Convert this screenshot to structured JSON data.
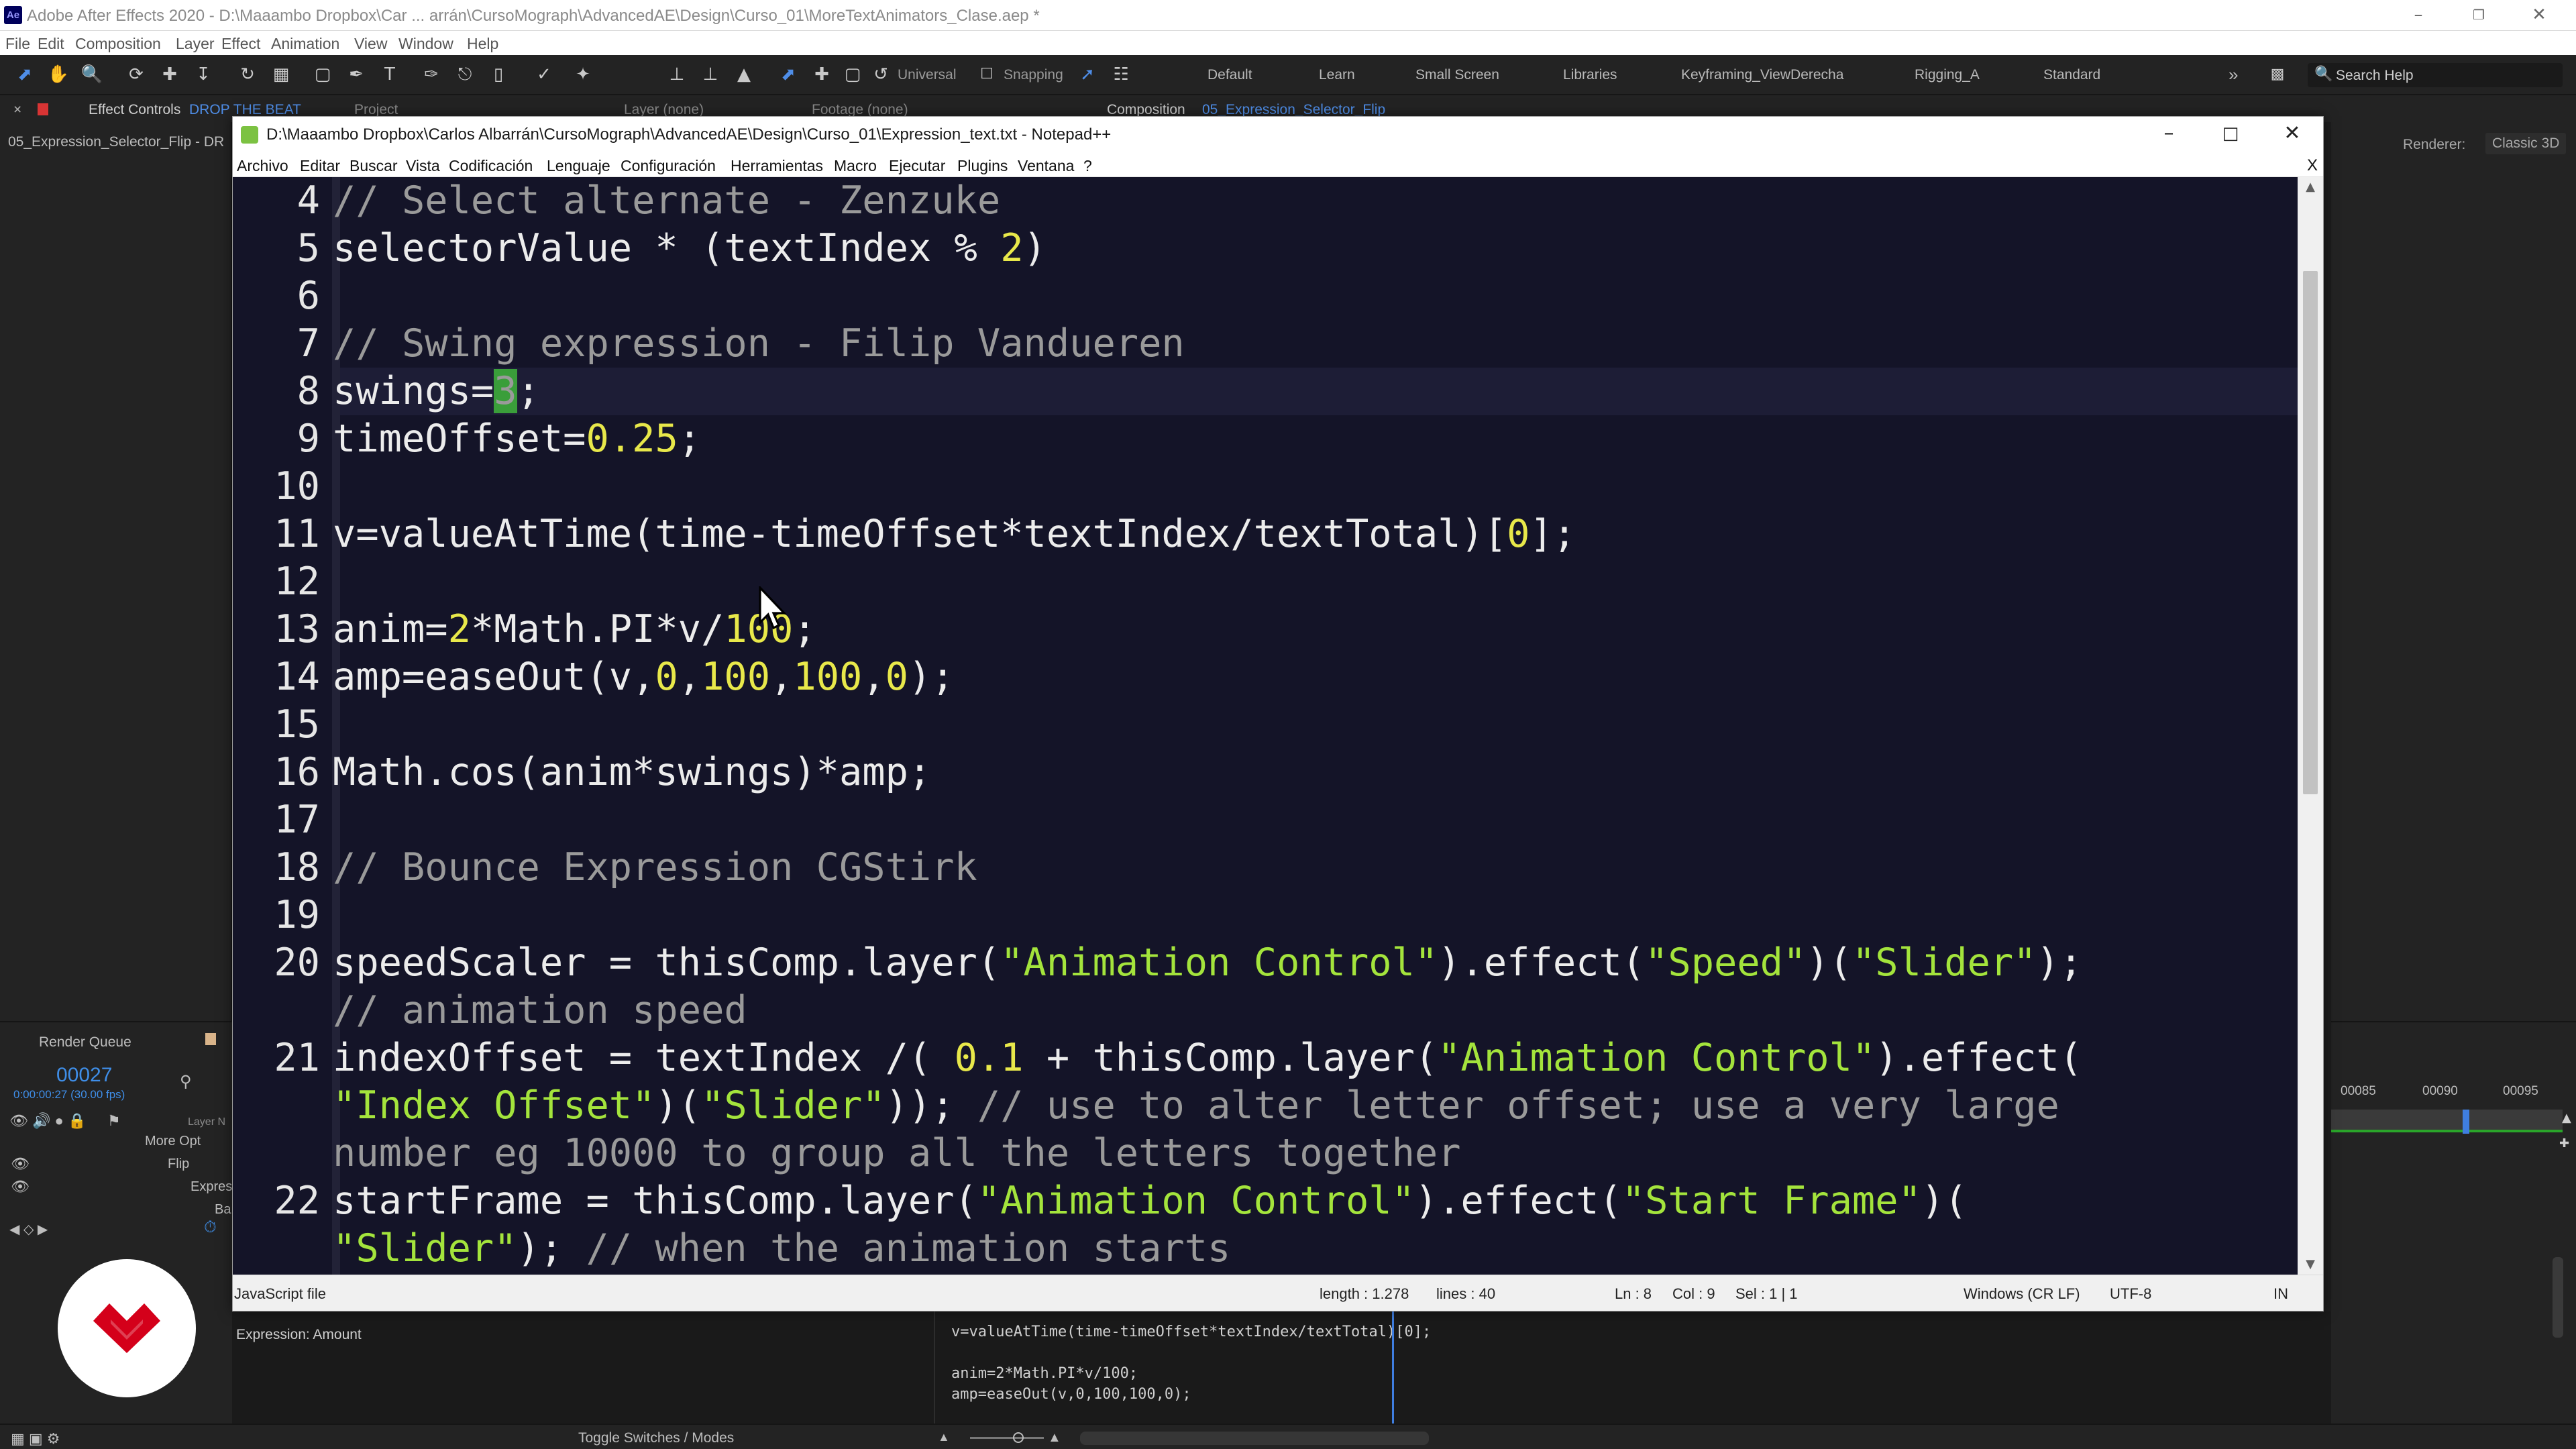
{
  "ae": {
    "title": "Adobe After Effects 2020 - D:\\Maaambo Dropbox\\Car ... arrán\\CursoMograph\\AdvancedAE\\Design\\Curso_01\\MoreTextAnimators_Clase.aep *",
    "logo_text": "Ae",
    "menu": [
      "File",
      "Edit",
      "Composition",
      "Layer",
      "Effect",
      "Animation",
      "View",
      "Window",
      "Help"
    ],
    "toolbar": {
      "axis_mode": "Universal",
      "snapping": "Snapping",
      "workspaces": [
        "Default",
        "Learn",
        "Small Screen",
        "Libraries",
        "Keyframing_ViewDerecha",
        "Rigging_A",
        "Standard"
      ],
      "more": "»",
      "search_placeholder": "Search Help"
    },
    "panel_tabs": {
      "effect_controls": "Effect Controls",
      "effect_controls_layer": "DROP THE BEAT",
      "project": "Project",
      "layer": "Layer (none)",
      "footage": "Footage (none)",
      "composition": "Composition",
      "composition_name": "05_Expression_Selector_Flip",
      "layer_path": "05_Expression_Selector_Flip - DR"
    },
    "renderer_label": "Renderer:",
    "renderer_value": "Classic 3D",
    "render_queue": "Render Queue",
    "timecode": "00027",
    "timecode_sub": "0:00:00:27 (30.00 fps)",
    "layer_name_col": "Layer N",
    "tree": [
      "More Opt",
      "Flip",
      "Expres",
      "Ba"
    ],
    "ruler_ticks": [
      "00085",
      "00090",
      "00095"
    ],
    "expression_label": "Expression: Amount",
    "expression_code": "v=valueAtTime(time-timeOffset*textIndex/textTotal)[0];\n\nanim=2*Math.PI*v/100;\namp=easeOut(v,0,100,100,0);",
    "toggle_switches": "Toggle Switches / Modes"
  },
  "npp": {
    "title": "D:\\Maaambo Dropbox\\Carlos Albarrán\\CursoMograph\\AdvancedAE\\Design\\Curso_01\\Expression_text.txt - Notepad++",
    "menu": [
      "Archivo",
      "Editar",
      "Buscar",
      "Vista",
      "Codificación",
      "Lenguaje",
      "Configuración",
      "Herramientas",
      "Macro",
      "Ejecutar",
      "Plugins",
      "Ventana",
      "?"
    ],
    "close_doc": "X",
    "line_numbers": [
      "4",
      "5",
      "6",
      "7",
      "8",
      "9",
      "10",
      "11",
      "12",
      "13",
      "14",
      "15",
      "16",
      "17",
      "18",
      "19",
      "20",
      "21",
      "22"
    ],
    "status": {
      "file_type": "JavaScript file",
      "length": "length : 1.278",
      "lines": "lines : 40",
      "ln": "Ln : 8",
      "col": "Col : 9",
      "sel": "Sel : 1 | 1",
      "eol": "Windows (CR LF)",
      "encoding": "UTF-8",
      "mode": "IN"
    },
    "code": {
      "l4": "// Select alternate - Zenzuke",
      "l5a": "selectorValue * (textIndex % ",
      "l5n": "2",
      "l5b": ")",
      "l7": "// Swing expression - Filip Vandueren",
      "l8a": "swings=",
      "l8n": "3",
      "l8b": ";",
      "l9a": "timeOffset=",
      "l9n": "0.25",
      "l9b": ";",
      "l11a": "v=valueAtTime(time-timeOffset*textIndex/textTotal)[",
      "l11n": "0",
      "l11b": "];",
      "l13a": "anim=",
      "l13n1": "2",
      "l13b": "*Math.PI*v/",
      "l13n2": "100",
      "l13c": ";",
      "l14a": "amp=easeOut(v,",
      "l14n1": "0",
      "l14c1": ",",
      "l14n2": "100",
      "l14c2": ",",
      "l14n3": "100",
      "l14c3": ",",
      "l14n4": "0",
      "l14b": ");",
      "l16": "Math.cos(anim*swings)*amp;",
      "l18": "// Bounce Expression CGStirk",
      "l20a": "speedScaler = thisComp.layer(",
      "l20s1": "\"Animation Control\"",
      "l20b": ").effect(",
      "l20s2": "\"Speed\"",
      "l20c": ")(",
      "l20s3": "\"Slider\"",
      "l20d": ");",
      "l20w": "// animation speed",
      "l21a": "indexOffset = textIndex /( ",
      "l21n": "0.1",
      "l21b": " + thisComp.layer(",
      "l21s1": "\"Animation Control\"",
      "l21c": ").effect(",
      "l21s2": "\"Index Offset\"",
      "l21d": ")(",
      "l21s3": "\"Slider\"",
      "l21e": ")); ",
      "l21cm1": "// use to alter letter offset; use a very large",
      "l21cm2": "number eg 10000 to group all the letters together",
      "l22a": "startFrame = thisComp.layer(",
      "l22s1": "\"Animation Control\"",
      "l22b": ").effect(",
      "l22s2": "\"Start Frame\"",
      "l22c": ")(",
      "l22s3": "\"Slider\"",
      "l22d": "); ",
      "l22cm": "// when the animation starts"
    }
  },
  "colors": {
    "editor_bg": "#141428",
    "comment": "#9a9a9a",
    "number": "#e8e84a",
    "string": "#a4e43c",
    "selection": "#3a9e3a",
    "ae_accent": "#3f7ee0",
    "brand": "#d4001a"
  }
}
